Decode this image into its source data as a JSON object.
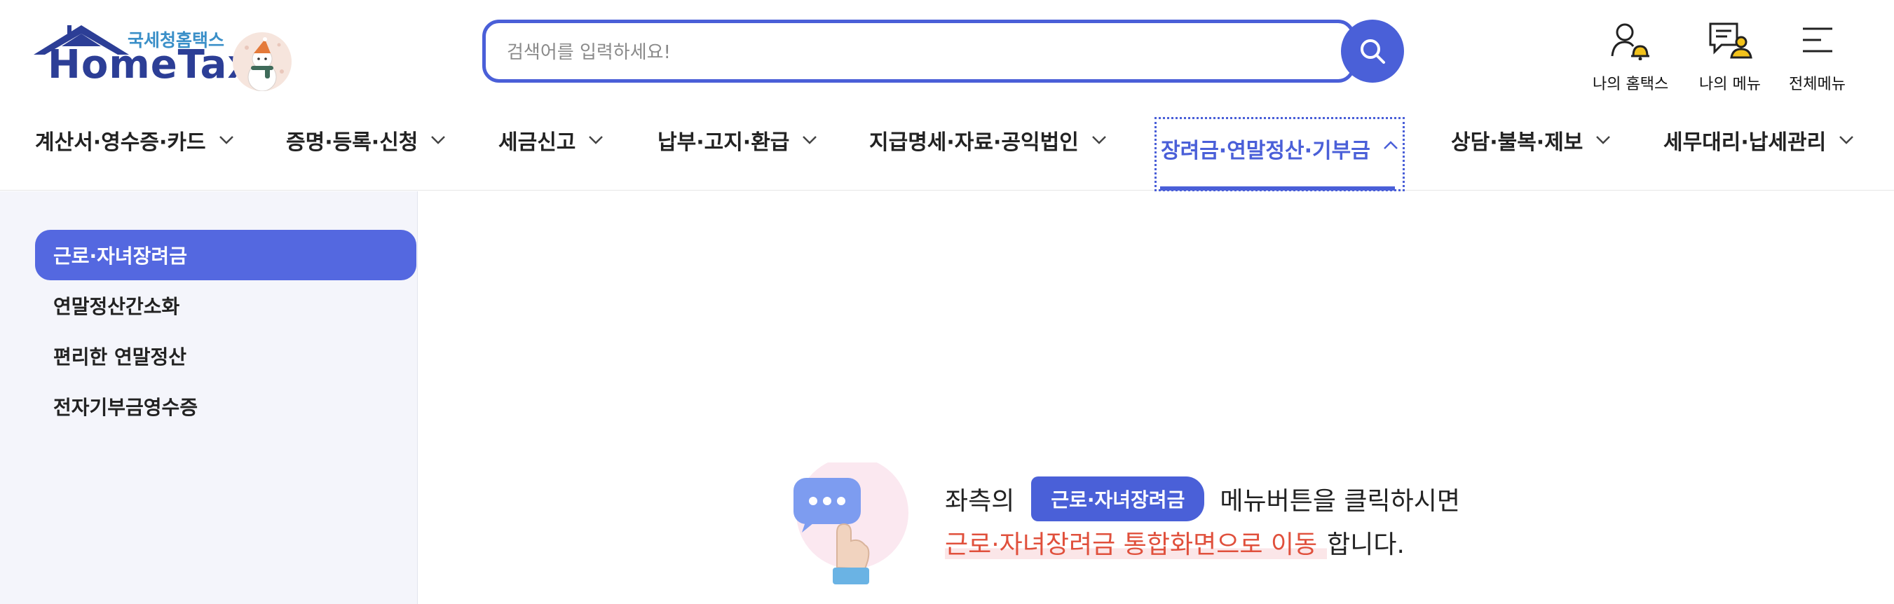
{
  "header": {
    "logo_sub": "국세청홈택스",
    "logo_main": "HomeTax",
    "search_placeholder": "검색어를 입력하세요!",
    "util": [
      {
        "label": "나의 홈택스",
        "icon": "user-bell-icon"
      },
      {
        "label": "나의 메뉴",
        "icon": "doc-user-icon"
      },
      {
        "label": "전체메뉴",
        "icon": "hamburger-icon"
      }
    ]
  },
  "nav": [
    {
      "label": "계산서·영수증·카드",
      "expanded": false
    },
    {
      "label": "증명·등록·신청",
      "expanded": false
    },
    {
      "label": "세금신고",
      "expanded": false
    },
    {
      "label": "납부·고지·환급",
      "expanded": false
    },
    {
      "label": "지급명세·자료·공익법인",
      "expanded": false
    },
    {
      "label": "장려금·연말정산·기부금",
      "expanded": true
    },
    {
      "label": "상담·불복·제보",
      "expanded": false
    },
    {
      "label": "세무대리·납세관리",
      "expanded": false
    }
  ],
  "sidebar": {
    "items": [
      {
        "label": "근로·자녀장려금",
        "active": true
      },
      {
        "label": "연말정산간소화",
        "active": false
      },
      {
        "label": "편리한 연말정산",
        "active": false
      },
      {
        "label": "전자기부금영수증",
        "active": false
      }
    ]
  },
  "main": {
    "msg_prefix": "좌측의",
    "msg_badge": "근로·자녀장려금",
    "msg_suffix": "메뉴버튼을 클릭하시면",
    "msg_highlight": "근로·자녀장려금 통합화면으로 이동",
    "msg_end": "합니다."
  },
  "colors": {
    "accent": "#4a60d8",
    "highlight_text": "#e0503c",
    "sidebar_bg": "#f4f5fb"
  }
}
